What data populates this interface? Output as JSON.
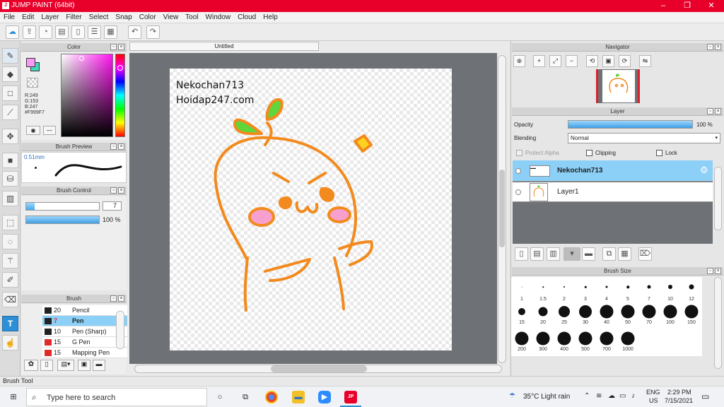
{
  "window": {
    "title": "JUMP PAINT (64bit)",
    "minimize": "–",
    "maximize": "❐",
    "close": "✕"
  },
  "menu": [
    "File",
    "Edit",
    "Layer",
    "Filter",
    "Select",
    "Snap",
    "Color",
    "View",
    "Tool",
    "Window",
    "Cloud",
    "Help"
  ],
  "color_panel": {
    "title": "Color",
    "r": "R:249",
    "g": "G:153",
    "b": "B:247",
    "hex": "#F999F7",
    "primary": "#f999f7",
    "secondary": "#40d8b8"
  },
  "brush_preview": {
    "title": "Brush Preview",
    "size": "0.51mm"
  },
  "brush_control": {
    "title": "Brush Control",
    "size_value": "7",
    "opacity_value": "100 %"
  },
  "brush_panel": {
    "title": "Brush",
    "items": [
      {
        "size": "20",
        "name": "Pencil",
        "color": "#222222"
      },
      {
        "size": "7",
        "name": "Pen",
        "color": "#e0272b"
      },
      {
        "size": "10",
        "name": "Pen (Sharp)",
        "color": "#222222"
      },
      {
        "size": "15",
        "name": "G Pen",
        "color": "#e02a2a"
      },
      {
        "size": "15",
        "name": "Mapping Pen",
        "color": "#e02a2a"
      }
    ]
  },
  "document": {
    "tab": "Untitled",
    "watermark_line1": "Nekochan713",
    "watermark_line2": "Hoidap247.com"
  },
  "navigator": {
    "title": "Navigator"
  },
  "layer_panel": {
    "title": "Layer",
    "opacity_label": "Opacity",
    "opacity_value": "100 %",
    "blending_label": "Blending",
    "blending_value": "Normal",
    "protect_alpha": "Protect Alpha",
    "clipping": "Clipping",
    "lock": "Lock",
    "layers": [
      {
        "name": "Nekochan713",
        "selected": true
      },
      {
        "name": "Layer1",
        "selected": false
      }
    ]
  },
  "brush_size": {
    "title": "Brush Size",
    "sizes": [
      {
        "l": "1",
        "p": 1
      },
      {
        "l": "1.5",
        "p": 1.5
      },
      {
        "l": "2",
        "p": 2
      },
      {
        "l": "3",
        "p": 2.5
      },
      {
        "l": "4",
        "p": 3
      },
      {
        "l": "5",
        "p": 3.5
      },
      {
        "l": "7",
        "p": 5
      },
      {
        "l": "10",
        "p": 6
      },
      {
        "l": "12",
        "p": 7
      },
      {
        "l": "15",
        "p": 10
      },
      {
        "l": "20",
        "p": 13
      },
      {
        "l": "25",
        "p": 16
      },
      {
        "l": "30",
        "p": 18
      },
      {
        "l": "40",
        "p": 19
      },
      {
        "l": "50",
        "p": 19
      },
      {
        "l": "70",
        "p": 19
      },
      {
        "l": "100",
        "p": 19
      },
      {
        "l": "150",
        "p": 19
      },
      {
        "l": "200",
        "p": 19
      },
      {
        "l": "300",
        "p": 19
      },
      {
        "l": "400",
        "p": 19
      },
      {
        "l": "500",
        "p": 19
      },
      {
        "l": "700",
        "p": 19
      },
      {
        "l": "1000",
        "p": 19
      }
    ]
  },
  "status": {
    "text": "Brush Tool"
  },
  "taskbar": {
    "search_placeholder": "Type here to search",
    "weather": "35°C  Light rain",
    "lang1": "ENG",
    "lang2": "US",
    "time": "2:29 PM",
    "date": "7/15/2021"
  },
  "colors": {
    "titlebar": "#e8002b",
    "accent": "#2d8fd5",
    "stroke": "#f28a1e"
  }
}
